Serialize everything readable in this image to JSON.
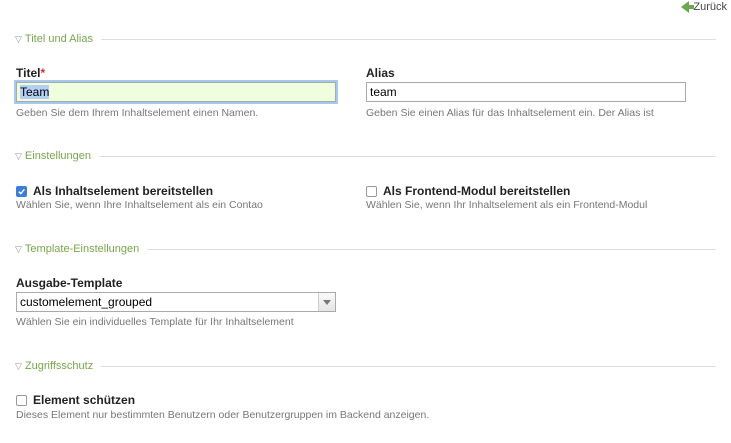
{
  "header": {
    "back_label": "Zurück"
  },
  "sections": {
    "title_alias": {
      "legend": "Titel und Alias"
    },
    "settings": {
      "legend": "Einstellungen"
    },
    "template": {
      "legend": "Template-Einstellungen"
    },
    "access": {
      "legend": "Zugriffsschutz"
    }
  },
  "fields": {
    "title": {
      "label": "Titel",
      "required_mark": "*",
      "value": "Team",
      "help": "Geben Sie dem Ihrem Inhaltselement einen Namen."
    },
    "alias": {
      "label": "Alias",
      "value": "team",
      "help": "Geben Sie einen Alias für das Inhaltselement ein. Der Alias ist"
    },
    "content_element": {
      "label": "Als Inhaltselement bereitstellen",
      "checked": true,
      "help": "Wählen Sie, wenn Ihre Inhaltselement als ein Contao"
    },
    "frontend_module": {
      "label": "Als Frontend-Modul bereitstellen",
      "checked": false,
      "help": "Wählen Sie, wenn Ihr Inhaltselement als ein Frontend-Modul"
    },
    "output_template": {
      "label": "Ausgabe-Template",
      "selected": "customelement_grouped",
      "help": "Wählen Sie ein individuelles Template für Ihr Inhaltselement"
    },
    "protect": {
      "label": "Element schützen",
      "checked": false,
      "help": "Dieses Element nur bestimmten Benutzern oder Benutzergruppen im Backend anzeigen."
    }
  },
  "colors": {
    "accent": "#77a64a",
    "focus_bg": "#efffde",
    "checkbox_checked": "#3b7fd8"
  },
  "icons": {
    "back": "arrow-left-icon",
    "legend_toggle": "triangle-down-icon",
    "checkmark": "checkmark-icon",
    "select_arrow": "chevron-down-icon"
  }
}
